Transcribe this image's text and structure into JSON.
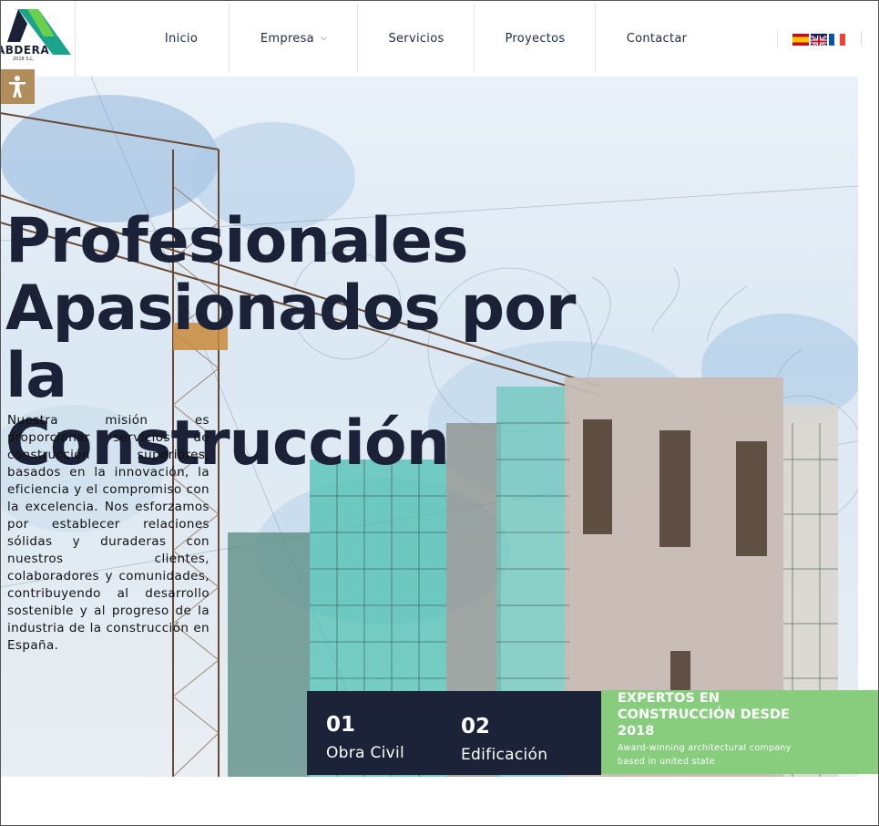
{
  "brand": {
    "name": "ABDERA",
    "sub": "2018 S.L."
  },
  "nav": {
    "items": [
      "Inicio",
      "Empresa",
      "Servicios",
      "Proyectos",
      "Contactar"
    ]
  },
  "languages": [
    "es",
    "en",
    "fr"
  ],
  "hero": {
    "title_lines": [
      "Profesionales",
      "Apasionados por la",
      "Construcción"
    ],
    "mission": "Nuestra misión es proporcionar servicios de construcción superiores, basados en la innovación, la eficiencia y el compromiso con la excelencia. Nos esforzamos por establecer relaciones sólidas y duraderas con nuestros clientes, colaboradores y comunidades, contribuyendo al desarrollo sostenible y al progreso de la industria de la construcción en España."
  },
  "services": [
    {
      "number": "01",
      "label": "Obra Civil"
    },
    {
      "number": "02",
      "label": "Edificación"
    }
  ],
  "experts": {
    "title": "EXPERTOS EN CONSTRUCCIÓN DESDE 2018",
    "subtitle": "Award-winning architectural company based in united state"
  },
  "colors": {
    "dark": "#1c2237",
    "green": "#88cd7e",
    "accessibility": "#b18d5c"
  }
}
